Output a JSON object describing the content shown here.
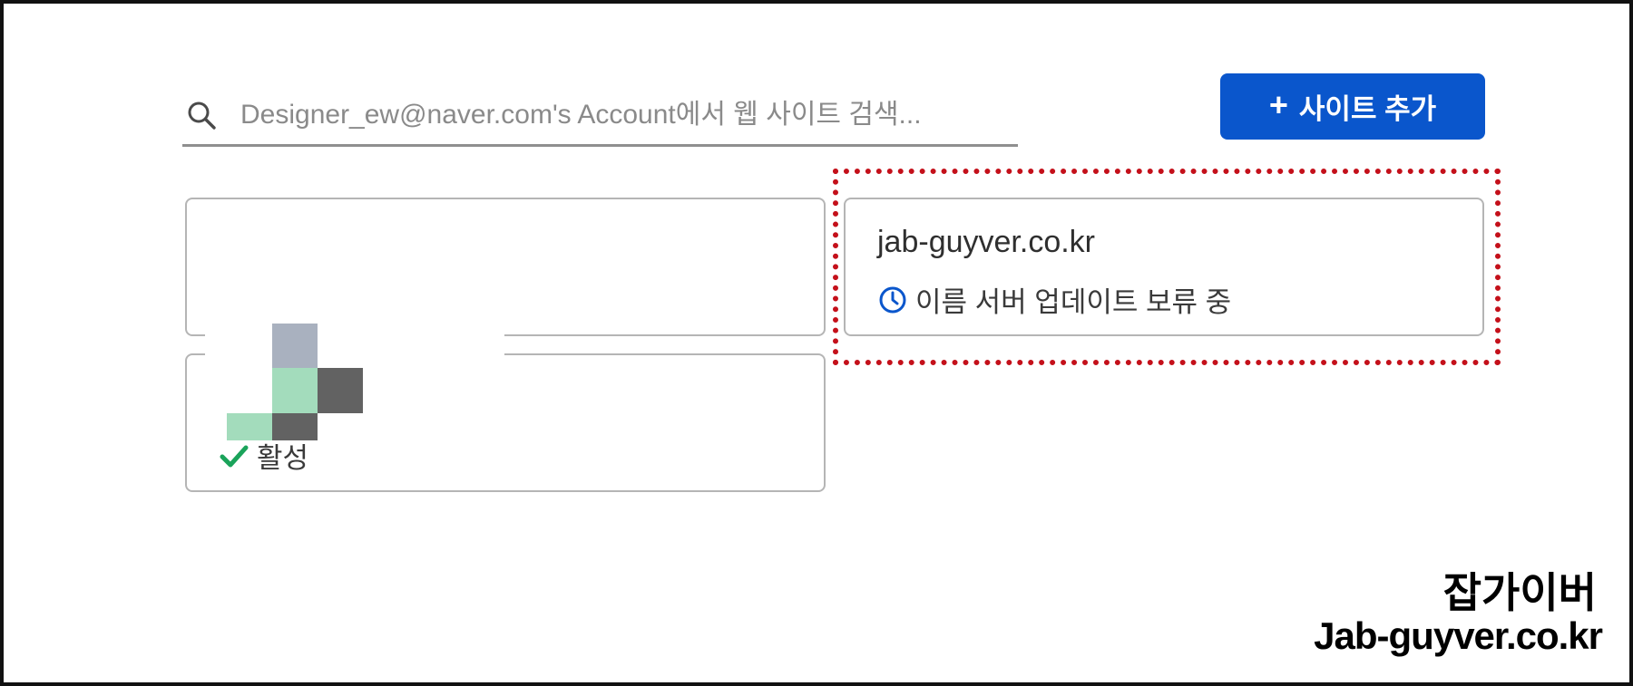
{
  "search": {
    "placeholder": "Designer_ew@naver.com's Account에서 웹 사이트 검색..."
  },
  "add_button": {
    "label": "사이트 추가",
    "icon": "plus-icon",
    "color": "#0a56cc"
  },
  "sites": [
    {
      "domain": "",
      "status": ""
    },
    {
      "domain": "jab-guyver.co.kr",
      "status": "이름 서버 업데이트 보류 중",
      "status_icon": "clock-icon",
      "status_icon_color": "#0a56cc"
    },
    {
      "domain": "",
      "status": "활성",
      "status_icon": "checkmark-icon",
      "status_icon_color": "#1aa35a"
    }
  ],
  "highlight_color": "#c4101a",
  "watermark": {
    "line1": "잡가이버",
    "line2": "Jab-guyver.co.kr"
  }
}
